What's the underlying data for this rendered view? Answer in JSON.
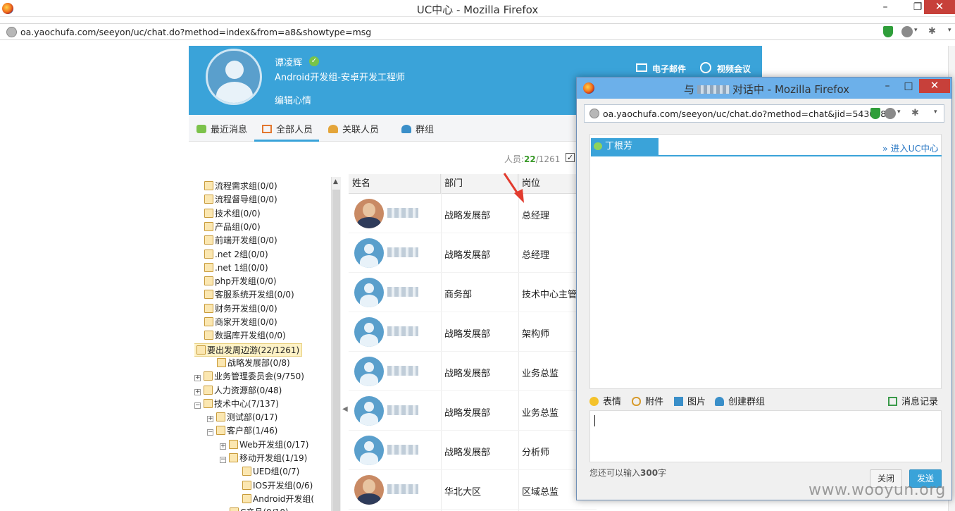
{
  "main_window": {
    "title": "UC中心 - Mozilla Firefox",
    "url": "oa.yaochufa.com/seeyon/uc/chat.do?method=index&from=a8&showtype=msg"
  },
  "profile": {
    "name": "谭凌辉",
    "department": "Android开发组-安卓开发工程师",
    "mood_link": "编辑心情",
    "email_label": "电子邮件",
    "video_label": "视频会议"
  },
  "tabs": [
    {
      "label": "最近消息"
    },
    {
      "label": "全部人员",
      "active": true
    },
    {
      "label": "关联人员"
    },
    {
      "label": "群组"
    }
  ],
  "member_count": {
    "prefix": "人员:",
    "online": "22",
    "total": "/1261"
  },
  "tree": [
    {
      "label": "流程需求组(0/0)",
      "level": 0
    },
    {
      "label": "流程督导组(0/0)",
      "level": 0
    },
    {
      "label": "技术组(0/0)",
      "level": 0
    },
    {
      "label": "产品组(0/0)",
      "level": 0
    },
    {
      "label": "前端开发组(0/0)",
      "level": 0
    },
    {
      "label": ".net 2组(0/0)",
      "level": 0
    },
    {
      "label": ".net 1组(0/0)",
      "level": 0
    },
    {
      "label": "php开发组(0/0)",
      "level": 0
    },
    {
      "label": "客服系统开发组(0/0)",
      "level": 0
    },
    {
      "label": "财务开发组(0/0)",
      "level": 0
    },
    {
      "label": "商家开发组(0/0)",
      "level": 0
    },
    {
      "label": "数据库开发组(0/0)",
      "level": 0
    },
    {
      "label": "要出发周边游(22/1261)",
      "level": -1,
      "toggle": "−",
      "selected": true
    },
    {
      "label": "战略发展部(0/8)",
      "level": 1
    },
    {
      "label": "业务管理委员会(9/750)",
      "level": 0,
      "toggle": "+"
    },
    {
      "label": "人力资源部(0/48)",
      "level": 0,
      "toggle": "+"
    },
    {
      "label": "技术中心(7/137)",
      "level": 0,
      "toggle": "−"
    },
    {
      "label": "测试部(0/17)",
      "level": 1,
      "toggle": "+"
    },
    {
      "label": "客户部(1/46)",
      "level": 1,
      "toggle": "−"
    },
    {
      "label": "Web开发组(0/17)",
      "level": 2,
      "toggle": "+"
    },
    {
      "label": "移动开发组(1/19)",
      "level": 2,
      "toggle": "−"
    },
    {
      "label": "UED组(0/7)",
      "level": 3
    },
    {
      "label": "IOS开发组(0/6)",
      "level": 3
    },
    {
      "label": "Android开发组(",
      "level": 3
    },
    {
      "label": "C产品(0/10)",
      "level": 2
    }
  ],
  "table": {
    "headers": [
      "姓名",
      "部门",
      "岗位"
    ],
    "rows": [
      {
        "dept": "战略发展部",
        "post": "总经理",
        "photo": true
      },
      {
        "dept": "战略发展部",
        "post": "总经理",
        "photo": false
      },
      {
        "dept": "商务部",
        "post": "技术中心主管",
        "photo": false
      },
      {
        "dept": "战略发展部",
        "post": "架构师",
        "photo": false
      },
      {
        "dept": "战略发展部",
        "post": "业务总监",
        "photo": false
      },
      {
        "dept": "战略发展部",
        "post": "业务总监",
        "photo": false
      },
      {
        "dept": "战略发展部",
        "post": "分析师",
        "photo": false
      },
      {
        "dept": "华北大区",
        "post": "区域总监",
        "photo": true
      }
    ]
  },
  "popup": {
    "title_prefix": "与",
    "title_suffix": "对话中 - Mozilla Firefox",
    "url": "oa.yaochufa.com/seeyon/uc/chat.do?method=chat&jid=543078",
    "chat_tab": "丁根芳",
    "enter_uc": "进入UC中心",
    "tools": {
      "emoji": "表情",
      "attach": "附件",
      "image": "图片",
      "group": "创建群组",
      "history": "消息记录"
    },
    "remaining_prefix": "您还可以输入",
    "remaining_count": "300",
    "remaining_suffix": "字",
    "close_btn": "关闭",
    "send_btn": "发送"
  },
  "watermark": "www.wooyun.org",
  "colors": {
    "accent": "#3aa3d9",
    "online": "#3a9a2a",
    "send": "#3aa3d9"
  }
}
